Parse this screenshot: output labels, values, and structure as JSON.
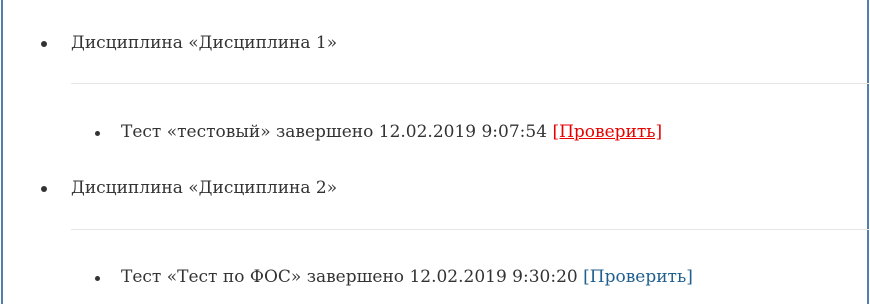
{
  "colors": {
    "frame_border": "#4f80b0",
    "text": "#333333",
    "link_active": "#e60000",
    "link_default": "#1f5f8f",
    "separator": "#e6e6e6"
  },
  "disciplines": [
    {
      "label": "Дисциплина «Дисциплина 1»",
      "tests": [
        {
          "text": "Тест «тестовый» завершено 12.02.2019 9:07:54",
          "action": "[Проверить]",
          "action_state": "hover"
        }
      ]
    },
    {
      "label": "Дисциплина «Дисциплина 2»",
      "tests": [
        {
          "text": "Тест «Тест по ФОС» завершено 12.02.2019 9:30:20",
          "action": "[Проверить]",
          "action_state": "normal"
        }
      ]
    }
  ]
}
